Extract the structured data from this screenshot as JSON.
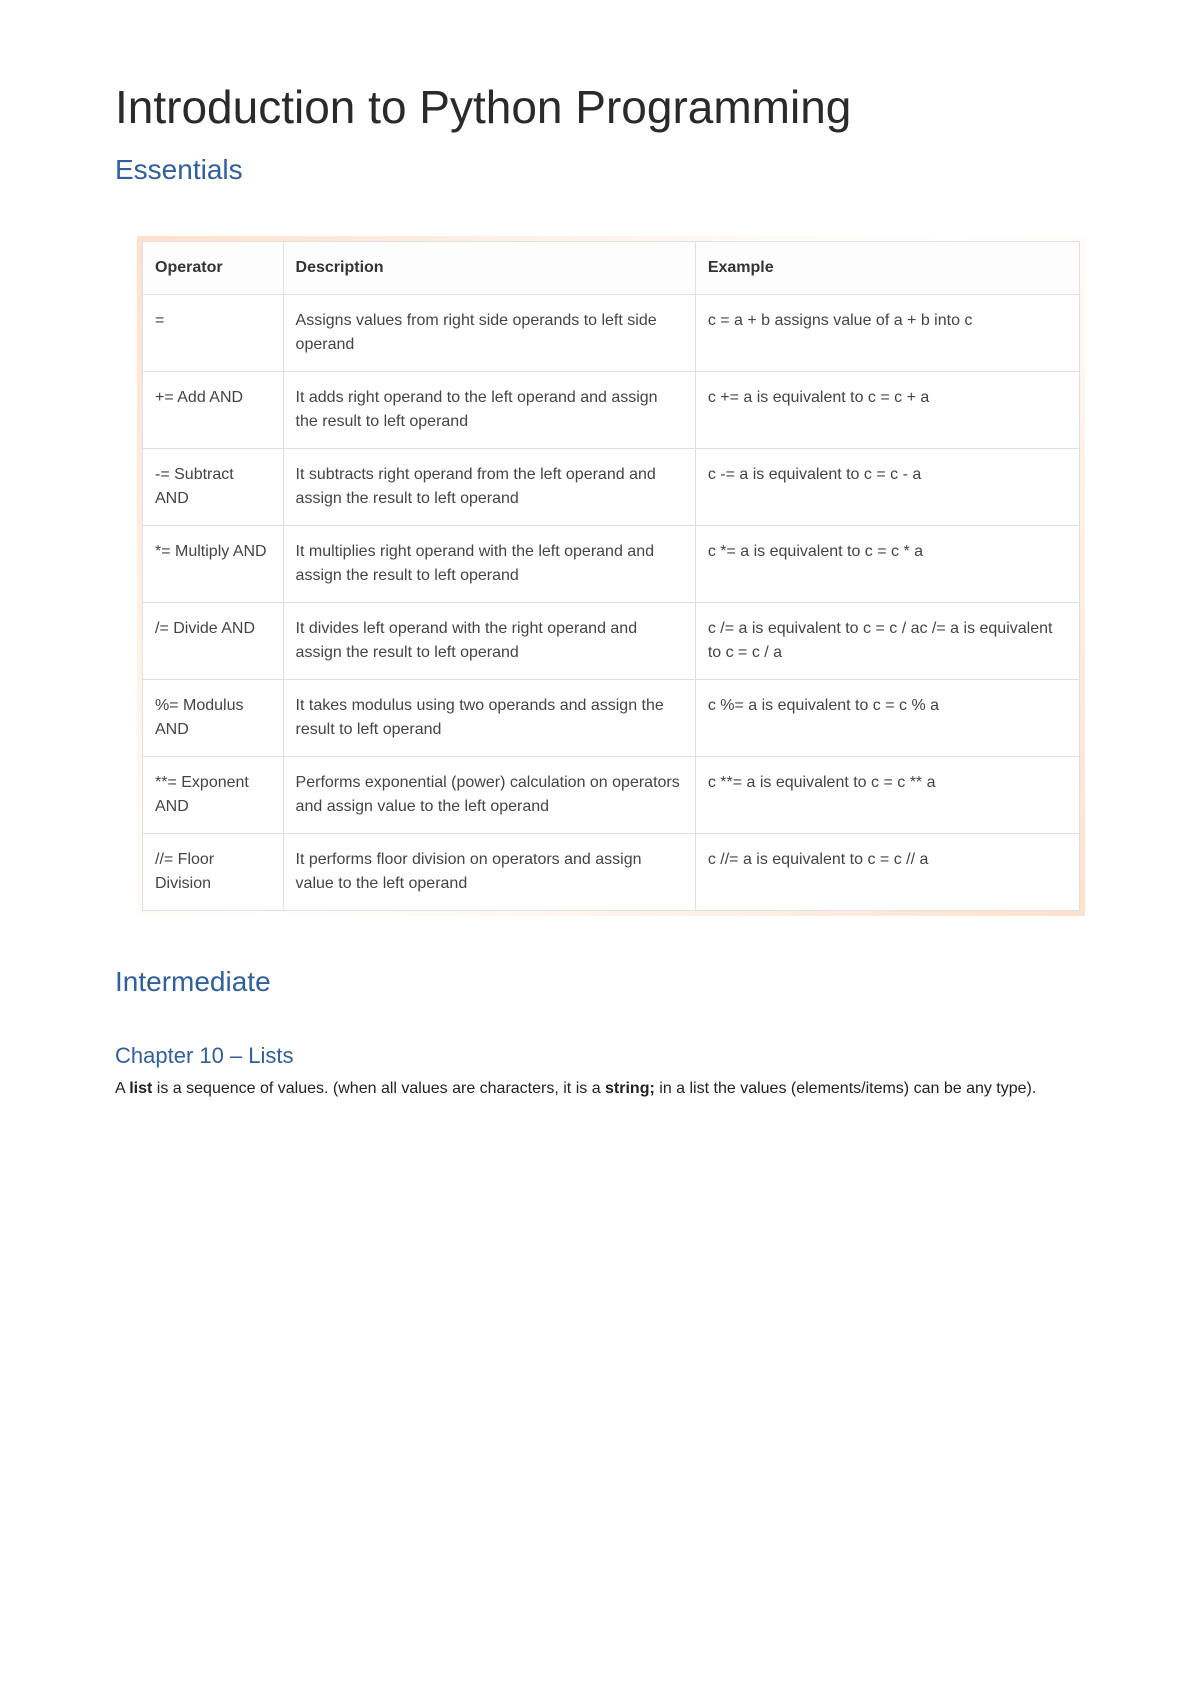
{
  "title": "Introduction to Python Programming",
  "sections": {
    "essentials_heading": "Essentials",
    "intermediate_heading": "Intermediate",
    "chapter10_heading": "Chapter 10 – Lists"
  },
  "table": {
    "headers": {
      "operator": "Operator",
      "description": "Description",
      "example": "Example"
    },
    "rows": [
      {
        "operator": "=",
        "description": "Assigns values from right side operands to left side operand",
        "example": "c = a + b assigns value of a + b into c"
      },
      {
        "operator": "+= Add AND",
        "description": "It adds right operand to the left operand and assign the result to left operand",
        "example": "c += a is equivalent to c = c + a"
      },
      {
        "operator": "-= Subtract AND",
        "description": "It subtracts right operand from the left operand and assign the result to left operand",
        "example": "c -= a is equivalent to c = c - a"
      },
      {
        "operator": "*= Multiply AND",
        "description": "It multiplies right operand with the left operand and assign the result to left operand",
        "example": "c *= a is equivalent to c = c * a"
      },
      {
        "operator": "/= Divide AND",
        "description": "It divides left operand with the right operand and assign the result to left operand",
        "example": "c /= a is equivalent to c = c / ac /= a is equivalent to c = c / a"
      },
      {
        "operator": "%= Modulus AND",
        "description": "It takes modulus using two operands and assign the result to left operand",
        "example": "c %= a is equivalent to c = c % a"
      },
      {
        "operator": "**= Exponent AND",
        "description": "Performs exponential (power) calculation on operators and assign value to the left operand",
        "example": "c **= a is equivalent to c = c ** a"
      },
      {
        "operator": "//= Floor Division",
        "description": "It performs floor division on operators and assign value to the left operand",
        "example": "c //= a is equivalent to c = c // a"
      }
    ]
  },
  "paragraph": {
    "p1": "A ",
    "p2": "list",
    "p3": " is a sequence of values. (when all values are characters, it is a ",
    "p4": "string;",
    "p5": " in a list the values (elements/items) can be any type)."
  }
}
